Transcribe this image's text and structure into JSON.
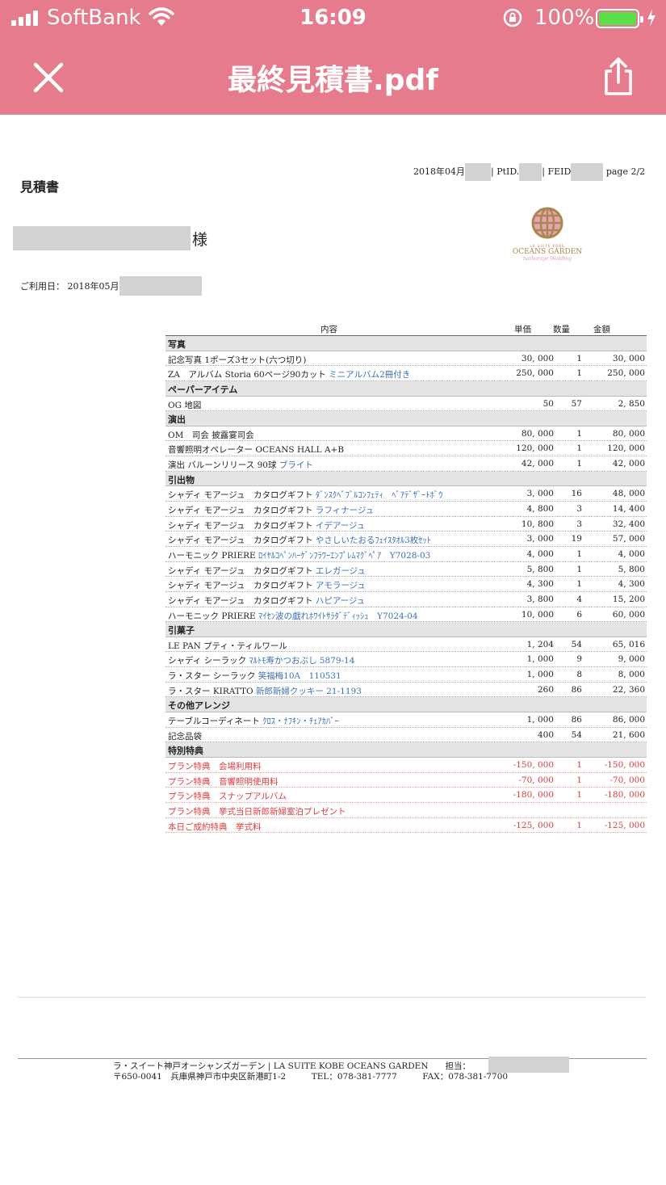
{
  "status_bar": {
    "carrier": "SoftBank",
    "time": "16:09",
    "battery_percent": "100%",
    "battery_level": 1.0,
    "accent_color": "#e57b8c"
  },
  "nav": {
    "title": "最終見積書.pdf",
    "close_icon": "close-icon",
    "share_icon": "share-icon"
  },
  "document": {
    "title": "見積書",
    "header": {
      "date_prefix": "2018年04月",
      "ptid_label": "| PtID.",
      "feid_label": "| FEID",
      "page": "page 2/2"
    },
    "customer_suffix": "様",
    "use_date_label": "ご利用日： 2018年05月",
    "logo": {
      "small": "LA SUITE KOBE",
      "brand": "OCEANS GARDEN",
      "sub": "harborage Wedding"
    },
    "columns": {
      "content": "内容",
      "unit_price": "単価",
      "quantity": "数量",
      "amount": "金額"
    },
    "sections": [
      {
        "category": "写真",
        "items": [
          {
            "name": "記念写真 1ポーズ3セット(六つ切り)",
            "note": "",
            "price": "30, 000",
            "qty": "1",
            "amount": "30, 000"
          },
          {
            "name": "ZA　アルバム Storia 60ページ90カット ",
            "note": "ミニアルバム2冊付き",
            "price": "250, 000",
            "qty": "1",
            "amount": "250, 000"
          }
        ]
      },
      {
        "category": "ペーパーアイテム",
        "items": [
          {
            "name": "OG 地図",
            "note": "",
            "price": "50",
            "qty": "57",
            "amount": "2, 850"
          }
        ]
      },
      {
        "category": "演出",
        "items": [
          {
            "name": "OM　司会 披露宴司会",
            "note": "",
            "price": "80, 000",
            "qty": "1",
            "amount": "80, 000"
          },
          {
            "name": "音響照明オペレーター OCEANS HALL A+B",
            "note": "",
            "price": "120, 000",
            "qty": "1",
            "amount": "120, 000"
          },
          {
            "name": "演出 バルーンリリース 90球 ",
            "note": "ブライト",
            "price": "42, 000",
            "qty": "1",
            "amount": "42, 000"
          }
        ]
      },
      {
        "category": "引出物",
        "items": [
          {
            "name": "シャディ モアージュ　カタログギフト ",
            "note": "ﾀﾞﾝｽｸﾍﾞﾌﾞﾙｺﾝﾌｪﾃｨ　ﾍﾞｱﾃﾞｻﾞｰﾄﾎﾞｳ",
            "price": "3, 000",
            "qty": "16",
            "amount": "48, 000"
          },
          {
            "name": "シャディ モアージュ　カタログギフト ",
            "note": "ラフィナージュ",
            "price": "4, 800",
            "qty": "3",
            "amount": "14, 400"
          },
          {
            "name": "シャディ モアージュ　カタログギフト ",
            "note": "イデアージュ",
            "price": "10, 800",
            "qty": "3",
            "amount": "32, 400"
          },
          {
            "name": "シャディ モアージュ　カタログギフト ",
            "note": "やさしいたおるﾌｪｲｽﾀｵﾙ3枚ｾｯﾄ",
            "price": "3, 000",
            "qty": "19",
            "amount": "57, 000"
          },
          {
            "name": "ハーモニック PRIERE ",
            "note": "ﾛｲﾔﾙｺﾍﾟﾝﾊｰｹﾞﾝﾌﾗﾜｰｴﾝﾌﾟﾚﾑﾏｸﾞﾍﾟｱ　Y7028-03",
            "price": "4, 000",
            "qty": "1",
            "amount": "4, 000"
          },
          {
            "name": "シャディ モアージュ　カタログギフト ",
            "note": "エレガージュ",
            "price": "5, 800",
            "qty": "1",
            "amount": "5, 800"
          },
          {
            "name": "シャディ モアージュ　カタログギフト ",
            "note": "アモラージュ",
            "price": "4, 300",
            "qty": "1",
            "amount": "4, 300"
          },
          {
            "name": "シャディ モアージュ　カタログギフト ",
            "note": "ハピアージュ",
            "price": "3, 800",
            "qty": "4",
            "amount": "15, 200"
          },
          {
            "name": "ハーモニック PRIERE ",
            "note": "ﾏｲｾﾝ波の戯れﾎﾜｲﾄｻﾗﾀﾞﾃﾞｨｯｼｭ　Y7024-04",
            "price": "10, 000",
            "qty": "6",
            "amount": "60, 000"
          }
        ]
      },
      {
        "category": "引菓子",
        "items": [
          {
            "name": "LE PAN プティ・ティルワール",
            "note": "",
            "price": "1, 204",
            "qty": "54",
            "amount": "65, 016"
          },
          {
            "name": "シャディ シーラック ",
            "note": "ﾏﾙﾄﾓ寿かつおぶし 5879-14",
            "price": "1, 000",
            "qty": "9",
            "amount": "9, 000"
          },
          {
            "name": "ラ・スター シーラック ",
            "note": "笑福梅10A　110531",
            "price": "1, 000",
            "qty": "8",
            "amount": "8, 000"
          },
          {
            "name": "ラ・スター KIRATTO ",
            "note": "新郎新婦クッキー 21-1193",
            "price": "260",
            "qty": "86",
            "amount": "22, 360"
          }
        ]
      },
      {
        "category": "その他アレンジ",
        "items": [
          {
            "name": "テーブルコーディネート ",
            "note": "ｸﾛｽ・ﾅﾌｷﾝ・ﾁｪｱｶﾊﾞｰ",
            "price": "1, 000",
            "qty": "86",
            "amount": "86, 000"
          },
          {
            "name": "記念品袋",
            "note": "",
            "price": "400",
            "qty": "54",
            "amount": "21, 600"
          }
        ]
      },
      {
        "category": "特別特典",
        "items": [
          {
            "name": "プラン特典　会場利用料",
            "note": "",
            "price": "-150, 000",
            "qty": "1",
            "amount": "-150, 000",
            "red": true
          },
          {
            "name": "プラン特典　音響照明使用料",
            "note": "",
            "price": "-70, 000",
            "qty": "1",
            "amount": "-70, 000",
            "red": true
          },
          {
            "name": "プラン特典　スナップアルバム",
            "note": "",
            "price": "-180, 000",
            "qty": "1",
            "amount": "-180, 000",
            "red": true
          },
          {
            "name": "プラン特典　挙式当日新郎新婦室泊プレゼント",
            "note": "",
            "price": "",
            "qty": "",
            "amount": "",
            "red": true
          },
          {
            "name": "本日ご成約特典　挙式料",
            "note": "",
            "price": "-125, 000",
            "qty": "1",
            "amount": "-125, 000",
            "red": true
          }
        ]
      }
    ],
    "footer": {
      "line1": "ラ・スイート神戸オーシャンズガーデン | LA SUITE KOBE OCEANS GARDEN　　担当：",
      "line2": "〒650-0041　兵庫県神戸市中央区新港町1-2　　　TEL：078-381-7777　　　FAX：078-381-7700"
    }
  }
}
